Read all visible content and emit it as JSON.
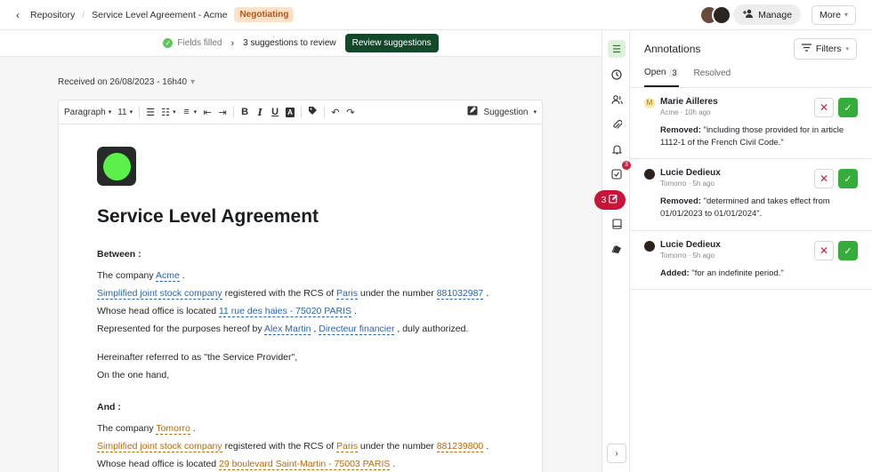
{
  "breadcrumb": {
    "root": "Repository",
    "document": "Service Level Agreement - Acme",
    "status": "Negotiating"
  },
  "header_actions": {
    "manage": "Manage",
    "more": "More"
  },
  "review_bar": {
    "fields": "Fields filled",
    "suggestions": "3 suggestions to review",
    "review_button": "Review suggestions"
  },
  "received": "Received on 26/08/2023 - 16h40",
  "editor_toolbar": {
    "paragraph": "Paragraph",
    "font_size": "11",
    "mode": "Suggestion"
  },
  "document": {
    "title": "Service Level Agreement",
    "between": "Between :",
    "party1": {
      "line1_pre": "The company ",
      "company": "Acme",
      "line1_post": " .",
      "legal_form": "Simplified joint stock company",
      "rcs_text": " registered with the RCS of ",
      "city": "Paris",
      "number_text": " under the number ",
      "number": "881032987",
      "number_post": " .",
      "office_pre": "Whose head office is located ",
      "address": "11 rue des haies - 75020 PARIS",
      "office_post": " .",
      "rep_pre": "Represented for the purposes hereof by ",
      "rep_name": "Alex Martin",
      "rep_sep": " , ",
      "rep_title": "Directeur financier",
      "rep_post": " , duly authorized."
    },
    "hereinafter": "Hereinafter referred to as \"the Service Provider\",",
    "one_hand": "On the one hand,",
    "and": "And :",
    "party2": {
      "line1_pre": "The company ",
      "company": "Tomorro",
      "line1_post": " .",
      "legal_form": "Simplified joint stock company",
      "rcs_text": " registered with the RCS of ",
      "city": "Paris",
      "number_text": " under the number ",
      "number": "881239800",
      "number_post": " .",
      "office_pre": "Whose head office is located ",
      "address": "29 boulevard Saint-Martin - 75003 PARIS",
      "office_post": " ."
    }
  },
  "rail": {
    "tasks_badge": "3",
    "suggestions_count": "3"
  },
  "annotations": {
    "title": "Annotations",
    "filters": "Filters",
    "tab_open": "Open",
    "tab_open_count": "3",
    "tab_resolved": "Resolved",
    "items": [
      {
        "initial": "M",
        "name": "Marie Ailleres",
        "meta": "Acme · 10h ago",
        "action": "Removed:",
        "text": " \"including those provided for in article 1112-1 of the French Civil Code.\""
      },
      {
        "initial": "",
        "name": "Lucie Dedieux",
        "meta": "Tomorro · 5h ago",
        "action": "Removed:",
        "text": " \"determined and takes effect from 01/01/2023 to 01/01/2024\"."
      },
      {
        "initial": "",
        "name": "Lucie Dedieux",
        "meta": "Tomorro · 5h ago",
        "action": "Added:",
        "text": " \"for an indefinite period.\""
      }
    ]
  }
}
